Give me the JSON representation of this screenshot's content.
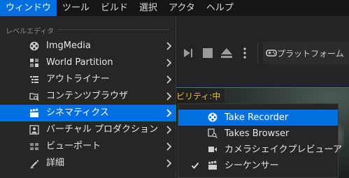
{
  "menubar": {
    "items": [
      {
        "label": "ウィンドウ",
        "active": true
      },
      {
        "label": "ツール"
      },
      {
        "label": "ビルド"
      },
      {
        "label": "選択"
      },
      {
        "label": "アクタ"
      },
      {
        "label": "ヘルプ"
      }
    ]
  },
  "toolbar": {
    "platform_label": "プラットフォーム"
  },
  "viewport": {
    "visibility_text": "ビリティ:中"
  },
  "dropdown": {
    "section_title": "レベルエディタ",
    "items": [
      {
        "label": "ImgMedia",
        "icon": "film-reel-icon",
        "has_submenu": true
      },
      {
        "label": "World Partition",
        "icon": "grid-icon",
        "has_submenu": true
      },
      {
        "label": "アウトライナー",
        "icon": "list-icon",
        "has_submenu": true
      },
      {
        "label": "コンテンツブラウザ",
        "icon": "folder-search-icon",
        "has_submenu": true
      },
      {
        "label": "シネマティクス",
        "icon": "clapperboard-icon",
        "has_submenu": true,
        "highlighted": true
      },
      {
        "label": "バーチャル プロダクション",
        "icon": "person-frame-icon",
        "has_submenu": true
      },
      {
        "label": "ビューポート",
        "icon": "viewport-icon",
        "has_submenu": true
      },
      {
        "label": "詳細",
        "icon": "pencil-icon",
        "has_submenu": true
      }
    ]
  },
  "submenu": {
    "items": [
      {
        "label": "Take Recorder",
        "icon": "film-reel-icon",
        "highlighted": true
      },
      {
        "label": "Takes Browser",
        "icon": "takes-browser-icon"
      },
      {
        "label": "カメラシェイクプレビューア",
        "icon": "video-camera-icon"
      },
      {
        "label": "シーケンサー",
        "icon": "clapperboard-icon",
        "checked": true
      }
    ]
  },
  "colors": {
    "accent": "#0070e0",
    "menu_bg": "#262626",
    "menubar_bg": "#151515",
    "warning_text": "#f0c040"
  }
}
